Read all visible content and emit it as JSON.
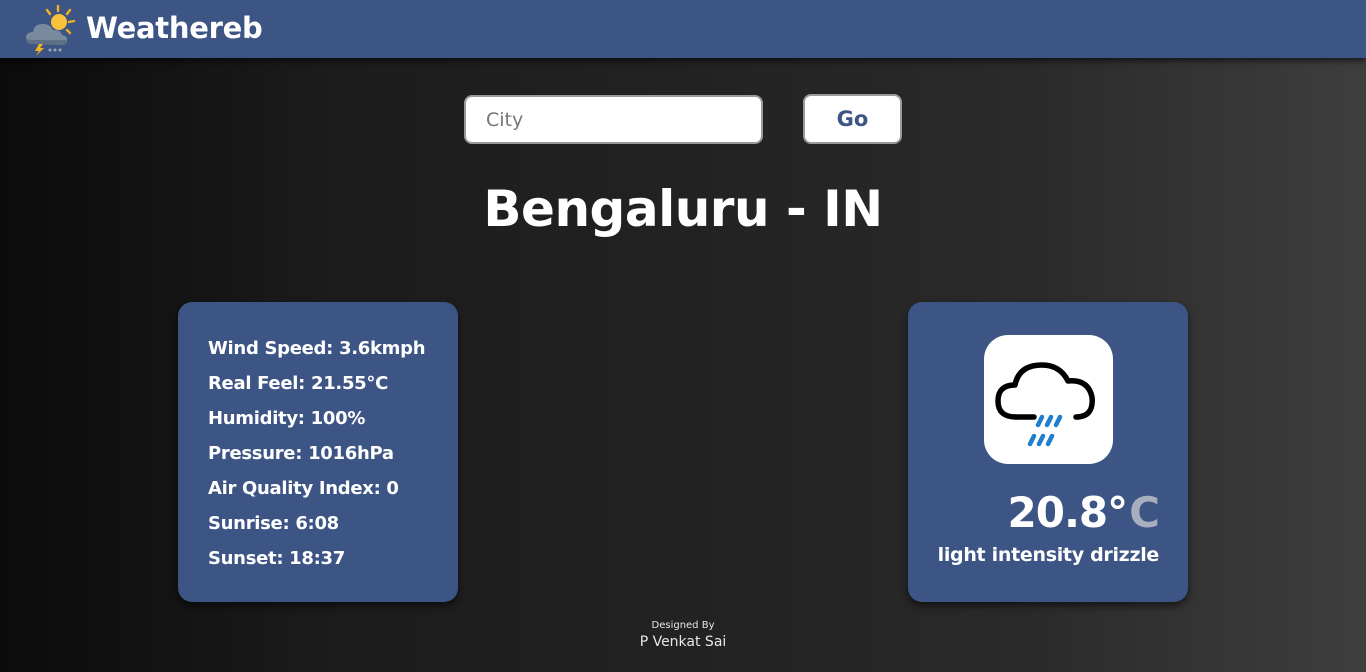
{
  "header": {
    "app_name": "Weathereb",
    "logo_icon": "sun-cloud-storm-icon"
  },
  "search": {
    "placeholder": "City",
    "value": "",
    "button_label": "Go"
  },
  "location": {
    "title": "Bengaluru - IN"
  },
  "details": {
    "items": [
      {
        "label": "Wind Speed: 3.6kmph"
      },
      {
        "label": "Real Feel: 21.55°C"
      },
      {
        "label": "Humidity: 100%"
      },
      {
        "label": "Pressure: 1016hPa"
      },
      {
        "label": "Air Quality Index: 0"
      },
      {
        "label": "Sunrise: 6:08"
      },
      {
        "label": "Sunset: 18:37"
      }
    ]
  },
  "current": {
    "icon": "rain-cloud-icon",
    "temperature": "20.8°",
    "unit": "C",
    "condition": "light intensity drizzle"
  },
  "footer": {
    "designed_by_label": "Designed By",
    "designer": "P Venkat Sai"
  },
  "colors": {
    "accent": "#3d5585",
    "rain": "#1e7fd0",
    "unit_text": "#a7afbf"
  }
}
